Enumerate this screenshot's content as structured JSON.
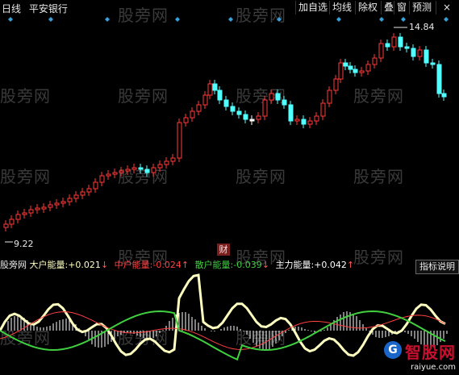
{
  "header": {
    "period": "日线",
    "stock_name": "平安银行",
    "buttons": [
      "加自选",
      "均线",
      "除权",
      "叠",
      "窗",
      "预测"
    ],
    "close_symbol": "×"
  },
  "watermark": {
    "text": "股旁网"
  },
  "main_chart": {
    "high_label": "14.84",
    "low_label": "9.22",
    "up_color": "#ff3b3b",
    "down_color": "#54ffff",
    "flat_color": "#ffffff",
    "marker_color": "#3aa0d8"
  },
  "indicator": {
    "name": "股旁网",
    "items": [
      {
        "label": "大户能量:",
        "value": "+0.021",
        "arrow": "↓",
        "color": "#ffffc0",
        "arrow_color": "#ff5555"
      },
      {
        "label": "中户能量:",
        "value": "-0.024",
        "arrow": "↑",
        "color": "#ff4040",
        "arrow_color": "#ff5555"
      },
      {
        "label": "散户能量:",
        "value": "-0.039",
        "arrow": "↓",
        "color": "#40d040",
        "arrow_color": "#ff5555"
      },
      {
        "label": "主力能量:",
        "value": "+0.042",
        "arrow": "↑",
        "color": "#ffffff",
        "arrow_color": "#ff5555"
      }
    ],
    "guide_button": "指标说明",
    "cai_badge": "财"
  },
  "site_logo": {
    "name": "智股网",
    "url_text": "raiyue.com"
  }
}
